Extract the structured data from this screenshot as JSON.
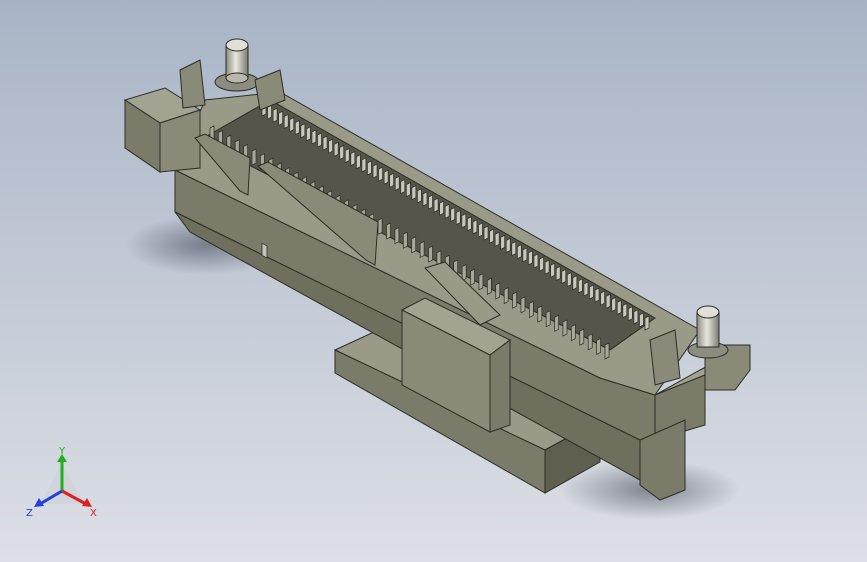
{
  "view": {
    "background_top": "#a8b4c6",
    "background_bottom": "#dcdfe5"
  },
  "model": {
    "name": "",
    "body_color": "#7b7b69",
    "top_color": "#9a9a88",
    "dark_color": "#4e4e42",
    "pin_color": "#cfcfc4"
  },
  "triad": {
    "x_label": "X",
    "y_label": "Y",
    "z_label": "Z",
    "x_color": "#e02020",
    "y_color": "#20b020",
    "z_color": "#2040e0"
  }
}
